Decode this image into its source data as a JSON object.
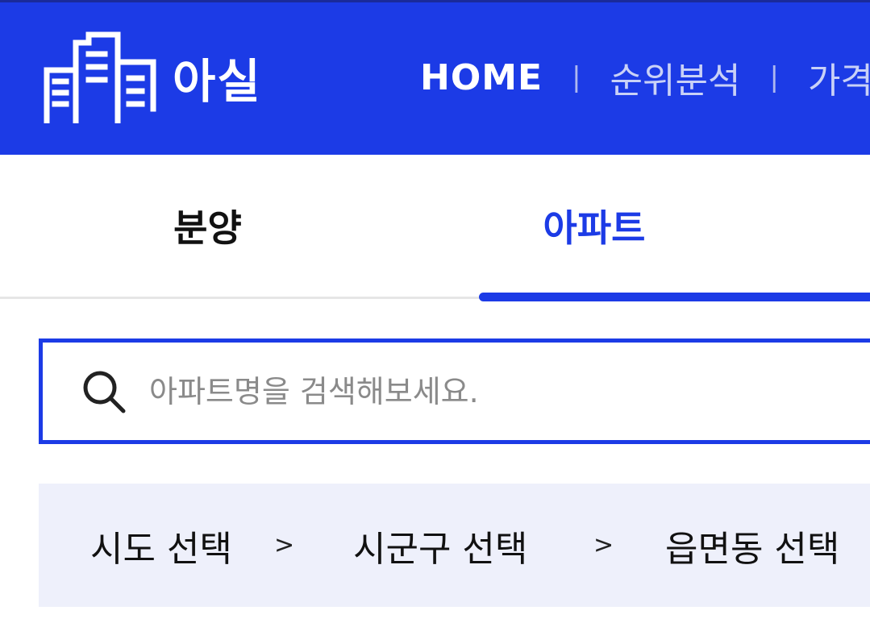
{
  "header": {
    "logo_text": "아실",
    "nav": [
      {
        "label": "HOME",
        "active": true
      },
      {
        "label": "순위분석",
        "active": false
      },
      {
        "label": "가격",
        "active": false
      }
    ],
    "separator": "|"
  },
  "tabs": [
    {
      "label": "분양",
      "selected": false
    },
    {
      "label": "아파트",
      "selected": true
    }
  ],
  "search": {
    "placeholder": "아파트명을 검색해보세요.",
    "value": ""
  },
  "breadcrumb": {
    "items": [
      "시도 선택",
      "시군구 선택",
      "읍면동 선택"
    ],
    "separator": ">"
  },
  "colors": {
    "brand": "#1c3be6",
    "crumb_background": "#eef0fb"
  },
  "icons": {
    "logo": "buildings-icon",
    "search": "search-icon"
  }
}
